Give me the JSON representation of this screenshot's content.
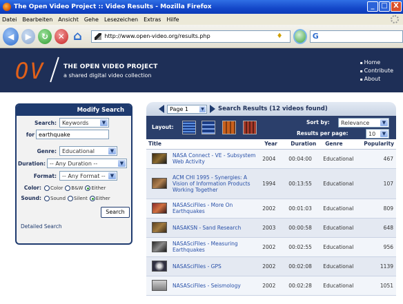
{
  "window": {
    "title": "The Open Video Project :: Video Results - Mozilla Firefox",
    "buttons": [
      "_",
      "□",
      "X"
    ]
  },
  "menu": [
    "Datei",
    "Bearbeiten",
    "Ansicht",
    "Gehe",
    "Lesezeichen",
    "Extras",
    "Hilfe"
  ],
  "toolbar": {
    "url": "http://www.open-video.org/results.php",
    "search_glyph": "G"
  },
  "site": {
    "logo": "OV",
    "title": "THE OPEN VIDEO PROJECT",
    "subtitle": "a shared digital video collection",
    "nav": [
      "Home",
      "Contribute",
      "About"
    ]
  },
  "modify_search": {
    "heading": "Modify Search",
    "search_label": "Search:",
    "search_type": "Keywords",
    "for_label": "for",
    "query": "earthquake",
    "genre_label": "Genre:",
    "genre": "Educational",
    "duration_label": "Duration:",
    "duration": "-- Any Duration --",
    "format_label": "Format:",
    "format": "-- Any Format --",
    "color_label": "Color:",
    "color_options": [
      "Color",
      "B&W",
      "Either"
    ],
    "sound_label": "Sound:",
    "sound_options": [
      "Sound",
      "Silent",
      "Either"
    ],
    "search_button": "Search",
    "detailed_link": "Detailed Search"
  },
  "results": {
    "page": "Page 1",
    "title": "Search Results (12 videos found)",
    "layout_label": "Layout:",
    "sort_label": "Sort by:",
    "sort_value": "Relevance",
    "rpp_label": "Results per page:",
    "rpp_value": "10",
    "columns": [
      "Title",
      "Year",
      "Duration",
      "Genre",
      "Popularity"
    ],
    "rows": [
      {
        "title": "NASA Connect - VE - Subsystem Web Activity",
        "year": "2004",
        "duration": "00:04:00",
        "genre": "Educational",
        "popularity": "467"
      },
      {
        "title": "ACM CHI 1995 - Synergies: A Vision of Information Products Working Together",
        "year": "1994",
        "duration": "00:13:55",
        "genre": "Educational",
        "popularity": "107"
      },
      {
        "title": "NASASciFiles - More On Earthquakes",
        "year": "2002",
        "duration": "00:01:03",
        "genre": "Educational",
        "popularity": "809"
      },
      {
        "title": "NASAKSN - Sand Research",
        "year": "2003",
        "duration": "00:00:58",
        "genre": "Educational",
        "popularity": "648"
      },
      {
        "title": "NASASciFiles - Measuring Earthquakes",
        "year": "2002",
        "duration": "00:02:55",
        "genre": "Educational",
        "popularity": "956"
      },
      {
        "title": "NASASciFiles - GPS",
        "year": "2002",
        "duration": "00:02:08",
        "genre": "Educational",
        "popularity": "1139"
      },
      {
        "title": "NASASciFiles - Seismology",
        "year": "2002",
        "duration": "00:02:28",
        "genre": "Educational",
        "popularity": "1051"
      }
    ]
  }
}
